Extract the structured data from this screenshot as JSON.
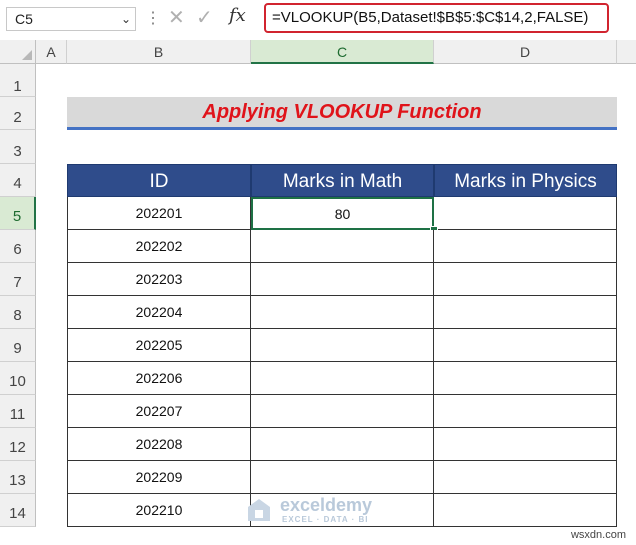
{
  "formula_bar": {
    "name_box": "C5",
    "formula": "=VLOOKUP(B5,Dataset!$B$5:$C$14,2,FALSE)",
    "fx_label": "fx"
  },
  "columns": [
    "A",
    "B",
    "C",
    "D"
  ],
  "rows": [
    "1",
    "2",
    "3",
    "4",
    "5",
    "6",
    "7",
    "8",
    "9",
    "10",
    "11",
    "12",
    "13",
    "14"
  ],
  "title": "Applying VLOOKUP Function",
  "table": {
    "headers": [
      "ID",
      "Marks in Math",
      "Marks in Physics"
    ],
    "rows": [
      {
        "id": "202201",
        "math": "80",
        "physics": ""
      },
      {
        "id": "202202",
        "math": "",
        "physics": ""
      },
      {
        "id": "202203",
        "math": "",
        "physics": ""
      },
      {
        "id": "202204",
        "math": "",
        "physics": ""
      },
      {
        "id": "202205",
        "math": "",
        "physics": ""
      },
      {
        "id": "202206",
        "math": "",
        "physics": ""
      },
      {
        "id": "202207",
        "math": "",
        "physics": ""
      },
      {
        "id": "202208",
        "math": "",
        "physics": ""
      },
      {
        "id": "202209",
        "math": "",
        "physics": ""
      },
      {
        "id": "202210",
        "math": "",
        "physics": ""
      }
    ]
  },
  "watermark": {
    "name": "exceldemy",
    "tagline": "EXCEL · DATA · BI"
  },
  "site_mark": "wsxdn.com",
  "colors": {
    "header_fill": "#2f4c8b",
    "title_text": "#e0131a",
    "title_rule": "#4472c4",
    "selection": "#1e7145"
  }
}
